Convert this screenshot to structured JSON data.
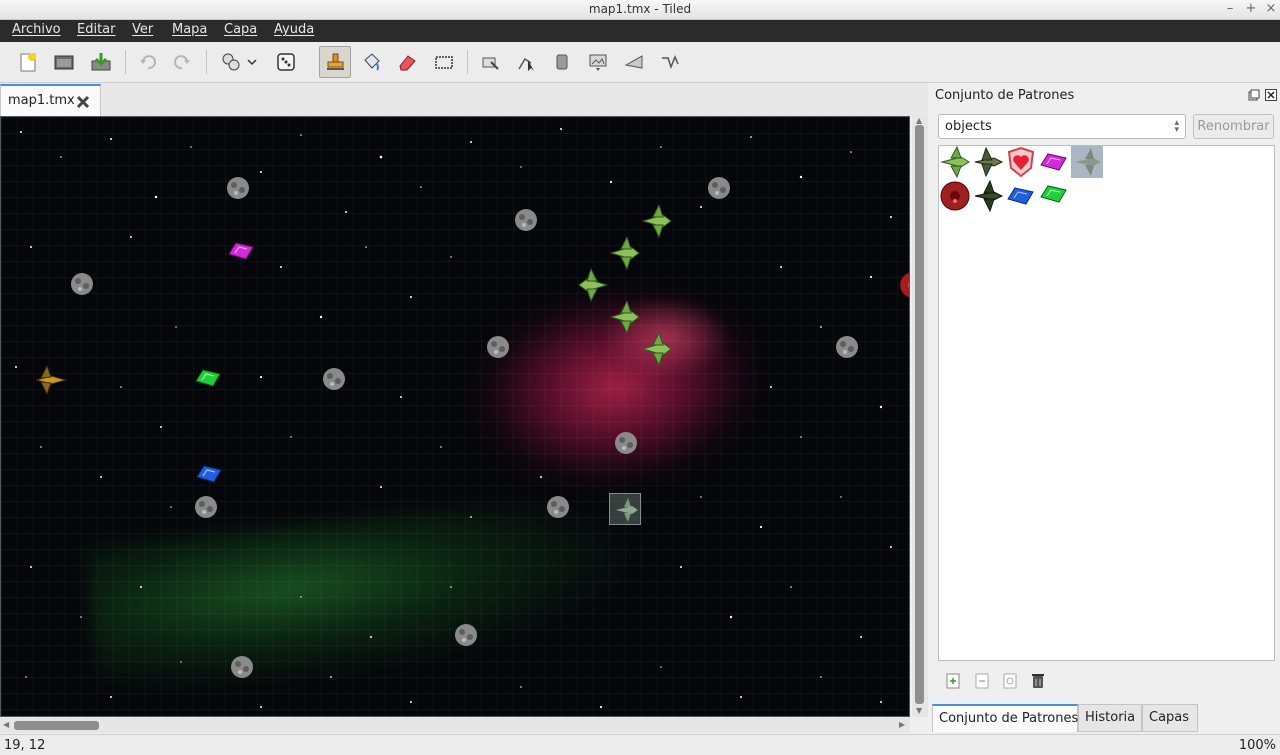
{
  "window": {
    "title": "map1.tmx - Tiled"
  },
  "menu": [
    "Archivo",
    "Editar",
    "Ver",
    "Mapa",
    "Capa",
    "Ayuda"
  ],
  "toolbar": {
    "tools": [
      "new-map-icon",
      "open-icon",
      "save-icon",
      "undo-icon",
      "redo-icon",
      "random-mode-icon",
      "dropdown-icon",
      "dice-icon",
      "stamp-brush-icon",
      "bucket-fill-icon",
      "eraser-icon",
      "rect-select-icon",
      "magic-wand-icon",
      "object-select-icon",
      "insert-rect-icon",
      "insert-image-icon",
      "insert-polygon-icon",
      "insert-polyline-icon"
    ],
    "active_tool": "stamp-brush-icon"
  },
  "document_tab": {
    "label": "map1.tmx"
  },
  "map": {
    "background": "#05060a",
    "objects": [
      "asteroid",
      "gem-magenta",
      "gem-green",
      "gem-blue",
      "green-fighter",
      "gold-fighter",
      "red-mine",
      "tile-preview"
    ]
  },
  "tileset_panel": {
    "title": "Conjunto de Patrones",
    "tileset_name": "objects",
    "rename_label": "Renombrar",
    "tiles": [
      "green-fighter",
      "dark-fighter",
      "heart-shield",
      "gem-magenta",
      "ghost-fighter",
      "red-mine",
      "dark-fighter-2",
      "gem-blue",
      "gem-green"
    ],
    "selected_tile": "ghost-fighter"
  },
  "bottom_tabs": [
    "Conjunto de Patrones",
    "Historia",
    "Capas"
  ],
  "active_bottom_tab": "Conjunto de Patrones",
  "status": {
    "coordinates": "19, 12",
    "zoom": "100%"
  }
}
